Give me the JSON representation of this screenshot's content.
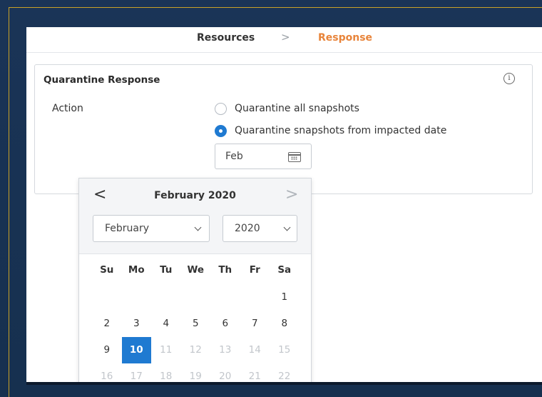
{
  "breadcrumb": {
    "resources": "Resources",
    "separator": ">",
    "response": "Response"
  },
  "card": {
    "title": "Quarantine Response",
    "info_icon": "i",
    "action_label": "Action",
    "options": [
      {
        "label": "Quarantine all snapshots",
        "selected": false
      },
      {
        "label": "Quarantine snapshots from impacted date",
        "selected": true
      }
    ],
    "date_value": "Feb"
  },
  "calendar": {
    "title": "February 2020",
    "prev_glyph": "<",
    "next_glyph": ">",
    "month_select": "February",
    "year_select": "2020",
    "weekdays": [
      "Su",
      "Mo",
      "Tu",
      "We",
      "Th",
      "Fr",
      "Sa"
    ],
    "weeks": [
      [
        "",
        "",
        "",
        "",
        "",
        "",
        "1"
      ],
      [
        "2",
        "3",
        "4",
        "5",
        "6",
        "7",
        "8"
      ],
      [
        "9",
        "10",
        "11",
        "12",
        "13",
        "14",
        "15"
      ],
      [
        "16",
        "17",
        "18",
        "19",
        "20",
        "21",
        "22"
      ]
    ],
    "selected_day": "10",
    "colors": {
      "accent": "#1f7ad1",
      "breadcrumb_active": "#e8843a"
    }
  }
}
